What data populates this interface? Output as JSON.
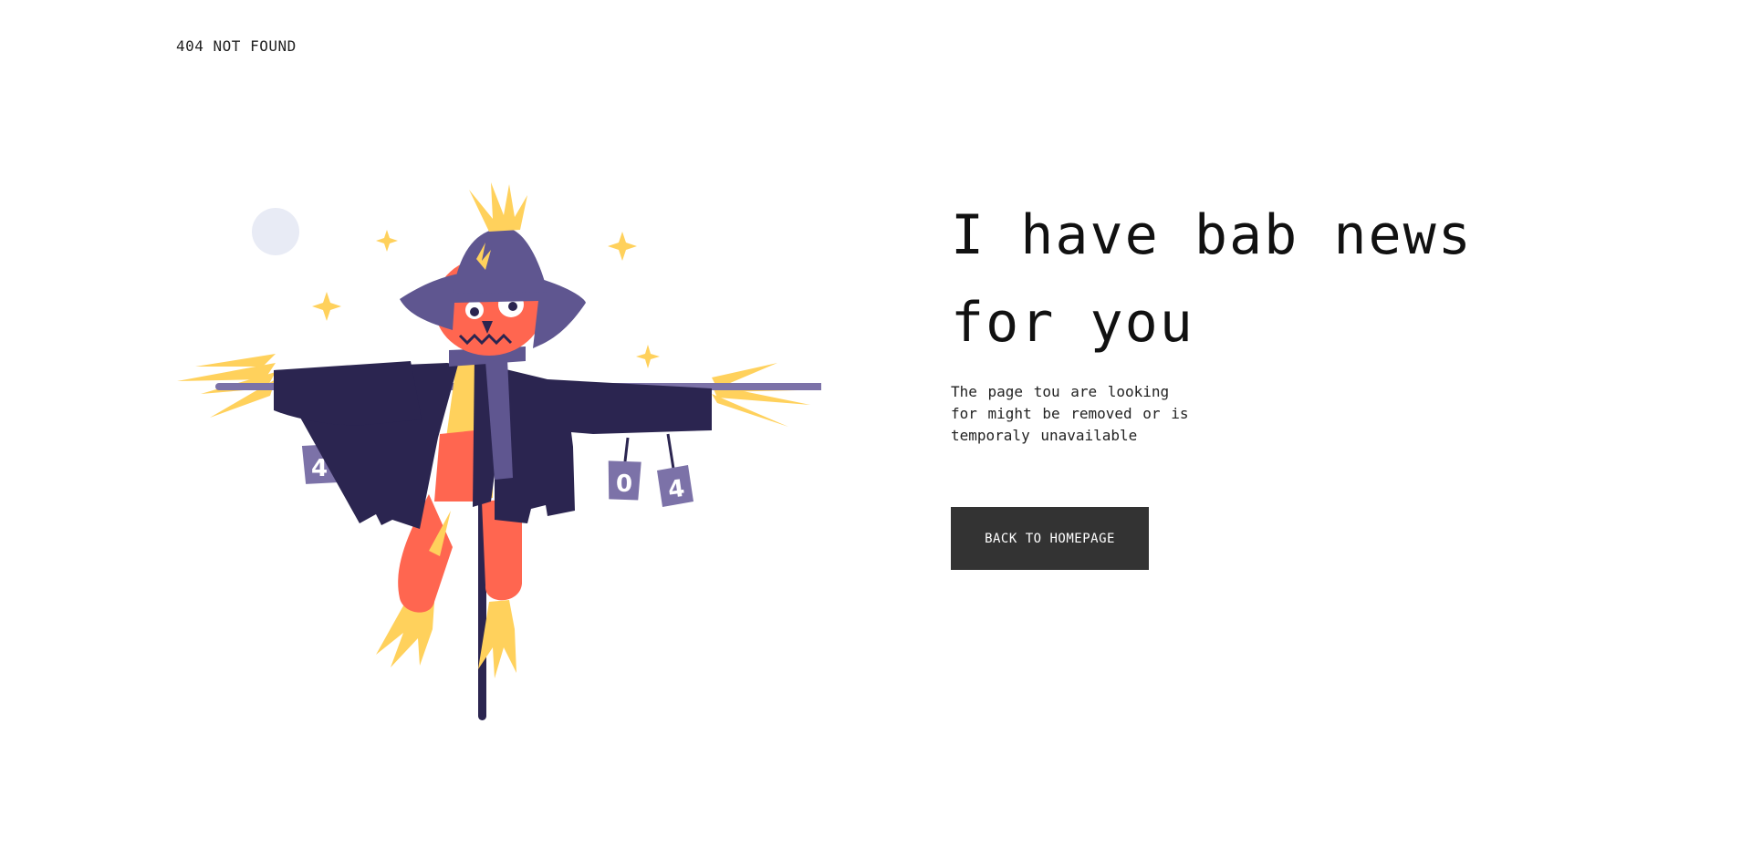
{
  "header": {
    "brand_text": "404 NOT FOUND"
  },
  "illustration": {
    "icon": "scarecrow-404-illustration",
    "can_labels": [
      "4",
      "0",
      "4"
    ]
  },
  "main": {
    "headline_line1": "I have bab news",
    "headline_line2": "for you",
    "description_line1": "The page tou are looking",
    "description_line2": "for might be removed or is",
    "description_line3": "temporaly unavailable",
    "cta_label": "BACK TO HOMEPAGE"
  },
  "colors": {
    "background": "#ffffff",
    "button": "#333333",
    "scarecrow_coat": "#2b2550",
    "scarecrow_hat": "#5f5690",
    "scarecrow_face": "#ff6650",
    "straw": "#ffd15c",
    "can": "#7c72a8"
  }
}
